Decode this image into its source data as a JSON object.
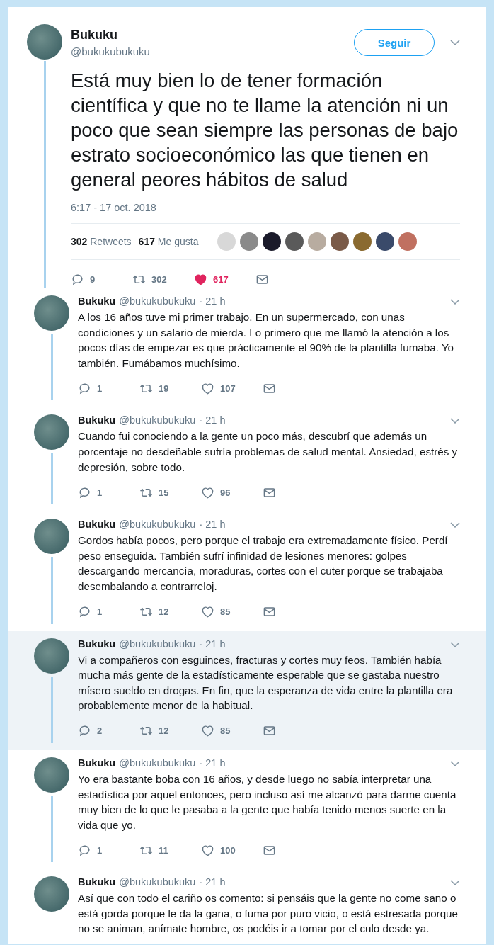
{
  "main_tweet": {
    "name": "Bukuku",
    "handle": "@bukukubukuku",
    "follow_button": "Seguir",
    "text": "Está muy bien lo de tener formación científica y que no te llame la atención ni un poco que sean siempre las personas de bajo estrato socioeconómico las que tienen en general peores hábitos de salud",
    "timestamp": "6:17 - 17 oct. 2018",
    "stats": [
      {
        "count": "302",
        "label": "Retweets"
      },
      {
        "count": "617",
        "label": "Me gusta"
      }
    ],
    "liker_avatars": [
      {
        "color": "#d8d8d8"
      },
      {
        "color": "#8a8a8a"
      },
      {
        "color": "#1a1a2a"
      },
      {
        "color": "#5a5a5a"
      },
      {
        "color": "#b8aca0"
      },
      {
        "color": "#7a5a48"
      },
      {
        "color": "#8a6a30"
      },
      {
        "color": "#3a4a6a"
      },
      {
        "color": "#c07060"
      }
    ],
    "replies": "9",
    "retweets": "302",
    "likes": "617",
    "liked": true
  },
  "thread": [
    {
      "name": "Bukuku",
      "handle": "@bukukubukuku",
      "time": "· 21 h",
      "highlighted": false,
      "text": "A los 16 años tuve mi primer trabajo. En un supermercado, con unas condiciones y un salario de mierda. Lo primero que me llamó la atención a los pocos días de empezar es que prácticamente el 90% de la plantilla fumaba. Yo también. Fumábamos muchísimo.",
      "replies": "1",
      "retweets": "19",
      "likes": "107",
      "liked": false
    },
    {
      "name": "Bukuku",
      "handle": "@bukukubukuku",
      "time": "· 21 h",
      "highlighted": false,
      "text": "Cuando fui conociendo a la gente un poco más, descubrí que además un porcentaje no desdeñable sufría problemas de salud mental. Ansiedad, estrés y depresión, sobre todo.",
      "replies": "1",
      "retweets": "15",
      "likes": "96",
      "liked": false
    },
    {
      "name": "Bukuku",
      "handle": "@bukukubukuku",
      "time": "· 21 h",
      "highlighted": false,
      "text": "Gordos había pocos, pero porque el trabajo era extremadamente físico. Perdí peso enseguida. También sufrí infinidad de lesiones menores: golpes descargando mercancía, moraduras, cortes con el cuter porque se trabajaba desembalando a contrarreloj.",
      "replies": "1",
      "retweets": "12",
      "likes": "85",
      "liked": false
    },
    {
      "name": "Bukuku",
      "handle": "@bukukubukuku",
      "time": "· 21 h",
      "highlighted": true,
      "text": "Vi a compañeros con esguinces, fracturas y cortes muy feos. También había mucha más gente de la estadísticamente esperable que se gastaba nuestro mísero sueldo en drogas. En fin, que la esperanza de vida entre la plantilla era probablemente menor de la habitual.",
      "replies": "2",
      "retweets": "12",
      "likes": "85",
      "liked": false
    },
    {
      "name": "Bukuku",
      "handle": "@bukukubukuku",
      "time": "· 21 h",
      "highlighted": false,
      "text": "Yo era bastante boba con 16 años, y desde luego no sabía interpretar una estadística por aquel entonces, pero incluso así me alcanzó para darme cuenta muy bien de lo que le pasaba a la gente que había tenido menos suerte en la vida que yo.",
      "replies": "1",
      "retweets": "11",
      "likes": "100",
      "liked": false
    },
    {
      "name": "Bukuku",
      "handle": "@bukukubukuku",
      "time": "· 21 h",
      "highlighted": false,
      "text": "Así que con todo el cariño os comento: si pensáis que la gente no come sano o está gorda porque le da la gana, o fuma por puro vicio, o está estresada porque no se animan, anímate hombre, os podéis ir a tomar por el culo desde ya."
    }
  ]
}
